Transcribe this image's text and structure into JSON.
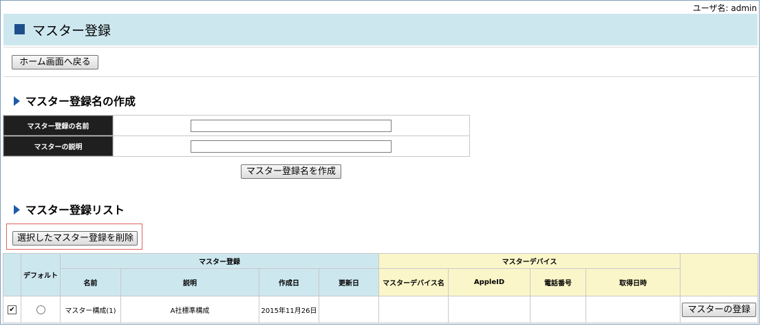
{
  "user": {
    "label": "ユーザ名: admin"
  },
  "header": {
    "title": "マスター登録"
  },
  "nav": {
    "home_button": "ホーム画面へ戻る"
  },
  "create_section": {
    "title": "マスター登録名の作成",
    "fields": [
      {
        "label": "マスター登録の名前",
        "value": ""
      },
      {
        "label": "マスターの説明",
        "value": ""
      }
    ],
    "create_button": "マスター登録名を作成"
  },
  "list_section": {
    "title": "マスター登録リスト",
    "delete_button": "選択したマスター登録を削除",
    "table": {
      "group_master_registration": "マスター登録",
      "group_master_device": "マスターデバイス",
      "col_default": "デフォルト",
      "col_name": "名前",
      "col_description": "説明",
      "col_created": "作成日",
      "col_updated": "更新日",
      "col_device_name": "マスターデバイス名",
      "col_apple_id": "AppleID",
      "col_phone": "電話番号",
      "col_acquired": "取得日時",
      "rows": [
        {
          "checked": true,
          "default_selected": false,
          "name": "マスター構成(1)",
          "description": "A社標準構成",
          "created": "2015年11月26日",
          "updated": "",
          "device_name": "",
          "apple_id": "",
          "phone": "",
          "acquired": "",
          "action_button": "マスターの登録"
        }
      ]
    }
  },
  "colors": {
    "header_bg": "#cde7ef",
    "device_header_bg": "#fbf6c9",
    "label_bg": "#1f1f1f",
    "accent": "#1f5aa8",
    "highlight": "#e06060"
  },
  "icons": [
    "square-icon",
    "triangle-right-icon",
    "checkbox-checked-icon",
    "radio-unchecked-icon"
  ]
}
